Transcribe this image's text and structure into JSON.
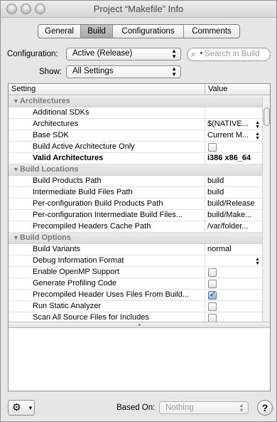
{
  "window": {
    "title": "Project “Makefile” Info"
  },
  "tabs": [
    {
      "label": "General",
      "selected": false
    },
    {
      "label": "Build",
      "selected": true
    },
    {
      "label": "Configurations",
      "selected": false
    },
    {
      "label": "Comments",
      "selected": false
    }
  ],
  "configuration": {
    "label": "Configuration:",
    "value": "Active (Release)"
  },
  "search": {
    "placeholder": "Search in Build"
  },
  "show": {
    "label": "Show:",
    "value": "All Settings"
  },
  "table": {
    "col_setting": "Setting",
    "col_value": "Value",
    "groups": [
      {
        "name": "Architectures",
        "rows": [
          {
            "name": "Additional SDKs",
            "value": "",
            "kind": "text"
          },
          {
            "name": "Architectures",
            "value": "$(NATIVE...",
            "kind": "popup"
          },
          {
            "name": "Base SDK",
            "value": "Current M...",
            "kind": "popup"
          },
          {
            "name": "Build Active Architecture Only",
            "value": "",
            "kind": "check",
            "checked": false
          },
          {
            "name": "Valid Architectures",
            "value": "i386 x86_64",
            "kind": "text",
            "bold": true
          }
        ]
      },
      {
        "name": "Build Locations",
        "rows": [
          {
            "name": "Build Products Path",
            "value": "build",
            "kind": "text"
          },
          {
            "name": "Intermediate Build Files Path",
            "value": "build",
            "kind": "text"
          },
          {
            "name": "Per-configuration Build Products Path",
            "value": "build/Release",
            "kind": "text"
          },
          {
            "name": "Per-configuration Intermediate Build Files...",
            "value": "build/Make...",
            "kind": "text"
          },
          {
            "name": "Precompiled Headers Cache Path",
            "value": "/var/folder...",
            "kind": "text"
          }
        ]
      },
      {
        "name": "Build Options",
        "rows": [
          {
            "name": "Build Variants",
            "value": "normal",
            "kind": "text"
          },
          {
            "name": "Debug Information Format",
            "value": "",
            "kind": "popup"
          },
          {
            "name": "Enable OpenMP Support",
            "value": "",
            "kind": "check",
            "checked": false
          },
          {
            "name": "Generate Profiling Code",
            "value": "",
            "kind": "check",
            "checked": false
          },
          {
            "name": "Precompiled Header Uses Files From Build...",
            "value": "",
            "kind": "check",
            "checked": true
          },
          {
            "name": "Run Static Analyzer",
            "value": "",
            "kind": "check",
            "checked": false
          },
          {
            "name": "Scan All Source Files for Includes",
            "value": "",
            "kind": "check",
            "checked": false
          }
        ]
      }
    ]
  },
  "bottom": {
    "gear_icon": "gear-icon",
    "based_on_label": "Based On:",
    "based_on_value": "Nothing",
    "help_label": "?"
  }
}
